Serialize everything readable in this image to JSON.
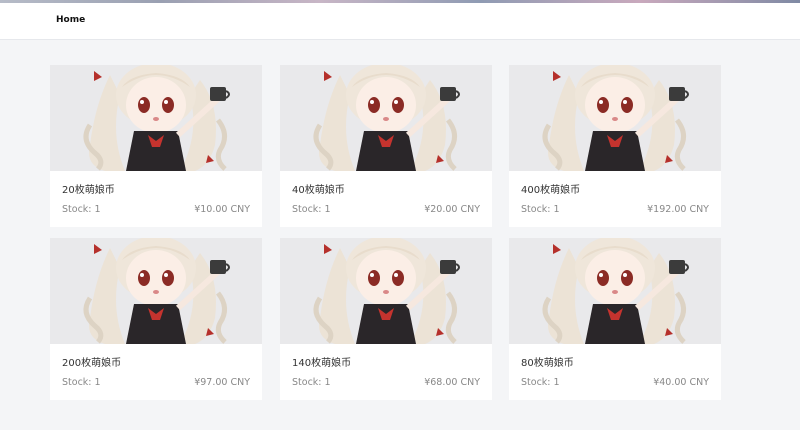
{
  "nav": {
    "home_label": "Home"
  },
  "products": [
    {
      "title": "20枚萌娘币",
      "stock_label": "Stock:",
      "stock": "1",
      "price": "¥10.00 CNY"
    },
    {
      "title": "40枚萌娘币",
      "stock_label": "Stock:",
      "stock": "1",
      "price": "¥20.00 CNY"
    },
    {
      "title": "400枚萌娘币",
      "stock_label": "Stock:",
      "stock": "1",
      "price": "¥192.00 CNY"
    },
    {
      "title": "200枚萌娘币",
      "stock_label": "Stock:",
      "stock": "1",
      "price": "¥97.00 CNY"
    },
    {
      "title": "140枚萌娘币",
      "stock_label": "Stock:",
      "stock": "1",
      "price": "¥68.00 CNY"
    },
    {
      "title": "80枚萌娘币",
      "stock_label": "Stock:",
      "stock": "1",
      "price": "¥40.00 CNY"
    }
  ]
}
